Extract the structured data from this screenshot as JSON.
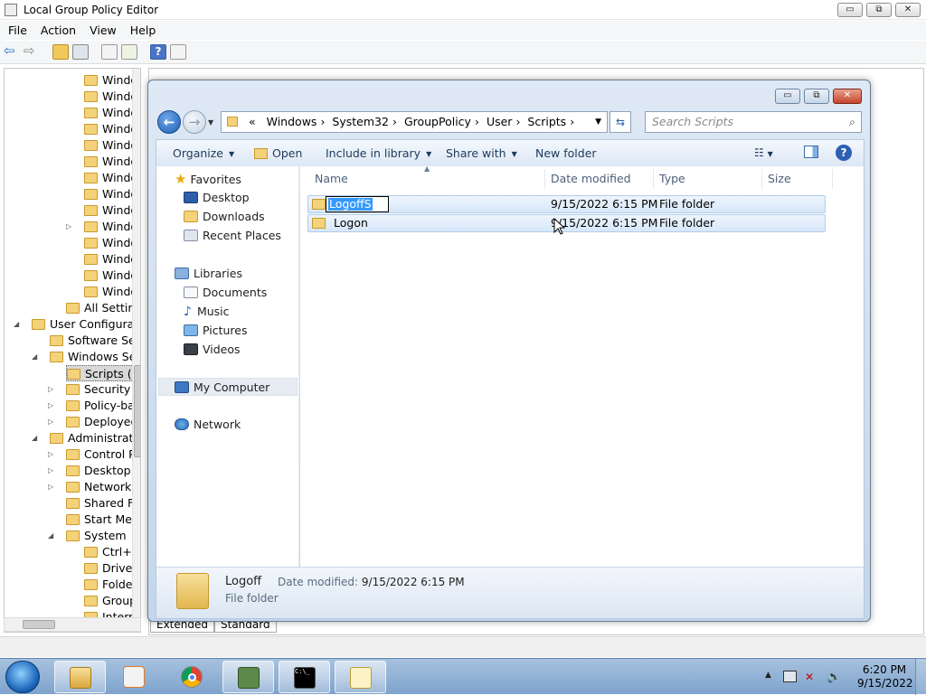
{
  "gpe": {
    "title": "Local Group Policy Editor",
    "menu": [
      "File",
      "Action",
      "View",
      "Help"
    ],
    "window_controls": {
      "minimize": "▭",
      "restore": "⧉",
      "close": "✕"
    },
    "tree": [
      {
        "label": "Window",
        "indent": 3,
        "expander": ""
      },
      {
        "label": "Window",
        "indent": 3,
        "expander": ""
      },
      {
        "label": "Window",
        "indent": 3,
        "expander": ""
      },
      {
        "label": "Window",
        "indent": 3,
        "expander": ""
      },
      {
        "label": "Window",
        "indent": 3,
        "expander": ""
      },
      {
        "label": "Window",
        "indent": 3,
        "expander": ""
      },
      {
        "label": "Window",
        "indent": 3,
        "expander": ""
      },
      {
        "label": "Window",
        "indent": 3,
        "expander": ""
      },
      {
        "label": "Window",
        "indent": 3,
        "expander": ""
      },
      {
        "label": "Window",
        "indent": 3,
        "expander": "▷"
      },
      {
        "label": "Window",
        "indent": 3,
        "expander": ""
      },
      {
        "label": "Window",
        "indent": 3,
        "expander": ""
      },
      {
        "label": "Window",
        "indent": 3,
        "expander": ""
      },
      {
        "label": "Window",
        "indent": 3,
        "expander": ""
      },
      {
        "label": "All Settings",
        "indent": 2,
        "expander": ""
      },
      {
        "label": "User Configuration",
        "indent": 0,
        "expander": "◢"
      },
      {
        "label": "Software Settings",
        "indent": 1,
        "expander": ""
      },
      {
        "label": "Windows Settings",
        "indent": 1,
        "expander": "◢"
      },
      {
        "label": "Scripts (Logon/Logoff)",
        "indent": 2,
        "expander": ""
      },
      {
        "label": "Security Settings",
        "indent": 2,
        "expander": "▷"
      },
      {
        "label": "Policy-based QoS",
        "indent": 2,
        "expander": "▷"
      },
      {
        "label": "Deployed Printers",
        "indent": 2,
        "expander": "▷"
      },
      {
        "label": "Administrative Templates",
        "indent": 1,
        "expander": "◢"
      },
      {
        "label": "Control Panel",
        "indent": 2,
        "expander": "▷"
      },
      {
        "label": "Desktop",
        "indent": 2,
        "expander": "▷"
      },
      {
        "label": "Network",
        "indent": 2,
        "expander": "▷"
      },
      {
        "label": "Shared Folders",
        "indent": 2,
        "expander": ""
      },
      {
        "label": "Start Menu and Taskbar",
        "indent": 2,
        "expander": ""
      },
      {
        "label": "System",
        "indent": 2,
        "expander": "◢"
      },
      {
        "label": "Ctrl+Alt+Del Options",
        "indent": 3,
        "expander": ""
      },
      {
        "label": "Driver Installation",
        "indent": 3,
        "expander": ""
      },
      {
        "label": "Folder Redirection",
        "indent": 3,
        "expander": ""
      },
      {
        "label": "Group Policy",
        "indent": 3,
        "expander": ""
      },
      {
        "label": "Internet",
        "indent": 3,
        "expander": ""
      }
    ],
    "tabs": [
      "Extended",
      "Standard"
    ]
  },
  "explorer": {
    "breadcrumb": [
      "Windows",
      "System32",
      "GroupPolicy",
      "User",
      "Scripts"
    ],
    "breadcrumb_prefix": "«",
    "search_placeholder": "Search Scripts",
    "commands": [
      "Organize",
      "Open",
      "Include in library",
      "Share with",
      "New folder"
    ],
    "nav": {
      "favorites_header": "Favorites",
      "favorites": [
        "Desktop",
        "Downloads",
        "Recent Places"
      ],
      "libraries_header": "Libraries",
      "libraries": [
        "Documents",
        "Music",
        "Pictures",
        "Videos"
      ],
      "computer": "My Computer",
      "network": "Network"
    },
    "columns": [
      "Name",
      "Date modified",
      "Type",
      "Size"
    ],
    "files": [
      {
        "name": "LogoffS",
        "date": "9/15/2022 6:15 PM",
        "type": "File folder",
        "size": ""
      },
      {
        "name": "Logon",
        "date": "9/15/2022 6:15 PM",
        "type": "File folder",
        "size": ""
      }
    ],
    "details": {
      "name": "Logoff",
      "modified_label": "Date modified:",
      "modified_value": "9/15/2022 6:15 PM",
      "type": "File folder"
    }
  },
  "taskbar": {
    "apps": [
      "explorer",
      "media-player",
      "chrome",
      "gpedit",
      "cmd",
      "notepad"
    ],
    "time": "6:20 PM",
    "date": "9/15/2022"
  }
}
